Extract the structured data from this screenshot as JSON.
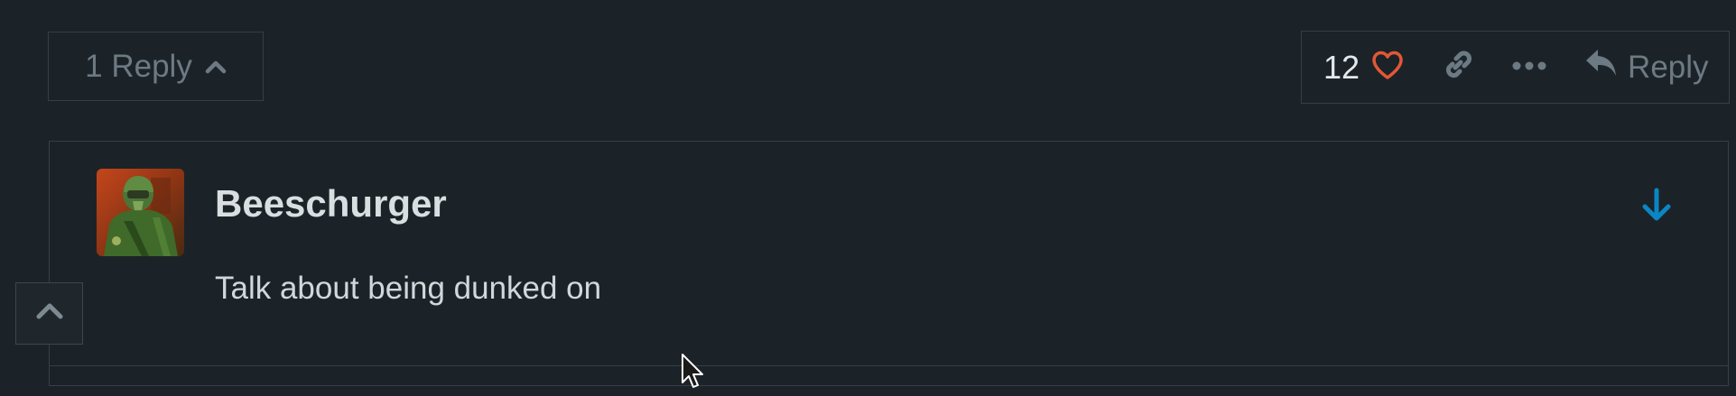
{
  "thread": {
    "replies_toggle_label": "1 Reply",
    "like_count": "12",
    "reply_label": "Reply"
  },
  "reply": {
    "username": "Beeschurger",
    "text": "Talk about being dunked on"
  },
  "icons": {
    "toggle": "chevron-up-icon",
    "like": "heart-icon",
    "link": "link-icon",
    "more": "ellipsis-icon",
    "reply": "reply-arrow-icon",
    "jump": "arrow-down-icon",
    "scroll_top": "chevron-up-icon"
  },
  "colors": {
    "background": "#1c2328",
    "border": "#353f46",
    "muted_text": "#6c7a83",
    "heart": "#e45735",
    "accent_blue": "#0b86c4"
  }
}
